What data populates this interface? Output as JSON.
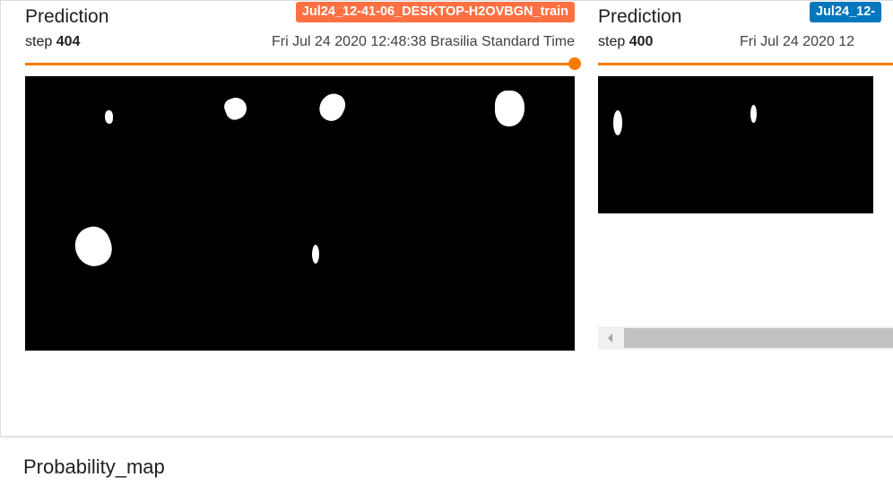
{
  "panes": [
    {
      "title": "Prediction",
      "run_tag": "Jul24_12-41-06_DESKTOP-H2OVBGN_train",
      "run_color": "#ff7043",
      "step_prefix": "step",
      "step": "404",
      "timestamp": "Fri Jul 24 2020 12:48:38 Brasilia Standard Time",
      "slider_color": "#f57c00",
      "slider_value": 1.0
    },
    {
      "title": "Prediction",
      "run_tag": "Jul24_12-",
      "run_color": "#0277bd",
      "step_prefix": "step",
      "step": "400",
      "timestamp": "Fri Jul 24 2020 12",
      "slider_color": "#f57c00"
    }
  ],
  "section_title": "Probability_map",
  "icons": {
    "scroll_left": "chevron-left-icon"
  }
}
